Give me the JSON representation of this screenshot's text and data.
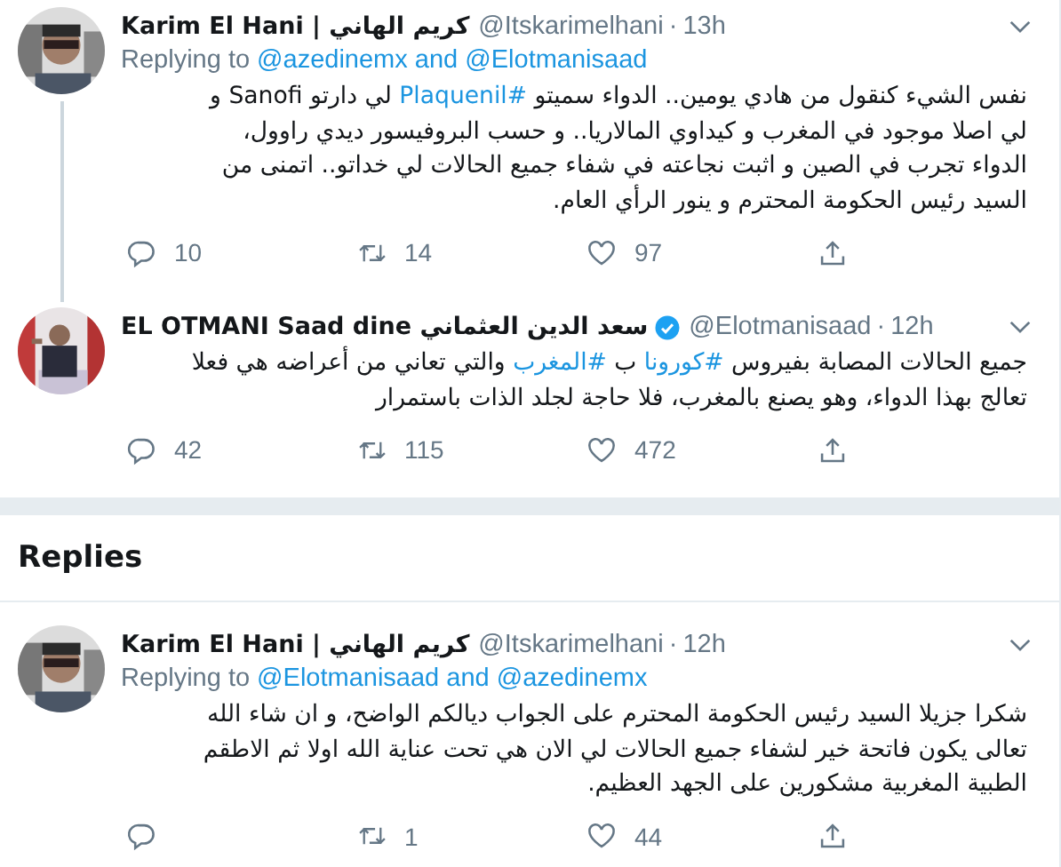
{
  "tweets": [
    {
      "name": "Karim El Hani | كريم الهاني",
      "handle": "@Itskarimelhani",
      "separator": "·",
      "time": "13h",
      "verified": false,
      "thread_line": true,
      "replying_label": "Replying to",
      "replying_to": "@azedinemx and @Elotmanisaad",
      "body": [
        {
          "kind": "text",
          "text": "نفس الشيء كنقول من هادي يومين.. الدواء سميتو "
        },
        {
          "kind": "link",
          "text": "#Plaquenil"
        },
        {
          "kind": "text",
          "text": " لي دارتو Sanofi و\nلي اصلا موجود في المغرب و كيداوي المالاريا.. و حسب البروفيسور ديدي راوول،\nالدواء تجرب في الصين و اثبت نجاعته في شفاء جميع الحالات لي خداتو.. اتمنى من\nالسيد رئيس الحكومة المحترم و ينور الرأي العام."
        }
      ],
      "replies": "10",
      "retweets": "14",
      "likes": "97"
    },
    {
      "name": "EL OTMANI Saad dine سعد الدين العثماني",
      "handle": "@Elotmanisaad",
      "separator": "·",
      "time": "12h",
      "verified": true,
      "thread_line": false,
      "body": [
        {
          "kind": "text",
          "text": "جميع الحالات المصابة بفيروس "
        },
        {
          "kind": "link",
          "text": "#كورونا"
        },
        {
          "kind": "text",
          "text": " ب "
        },
        {
          "kind": "link",
          "text": "#المغرب"
        },
        {
          "kind": "text",
          "text": " والتي تعاني من أعراضه هي فعلا\nتعالج بهذا الدواء، وهو يصنع بالمغرب، فلا حاجة لجلد الذات باستمرار"
        }
      ],
      "replies": "42",
      "retweets": "115",
      "likes": "472"
    }
  ],
  "section_title": "Replies",
  "replies": [
    {
      "name": "Karim El Hani | كريم الهاني",
      "handle": "@Itskarimelhani",
      "separator": "·",
      "time": "12h",
      "verified": false,
      "thread_line": false,
      "replying_label": "Replying to",
      "replying_to": "@Elotmanisaad and @azedinemx",
      "body": [
        {
          "kind": "text",
          "text": "شكرا جزيلا السيد رئيس الحكومة المحترم على الجواب ديالكم الواضح، و ان شاء الله\nتعالى يكون فاتحة خير لشفاء جميع الحالات لي الان هي تحت عناية الله اولا ثم الاطقم\nالطبية المغربية مشكورين على الجهد العظيم."
        }
      ],
      "retweets": "1",
      "likes": "44"
    }
  ]
}
